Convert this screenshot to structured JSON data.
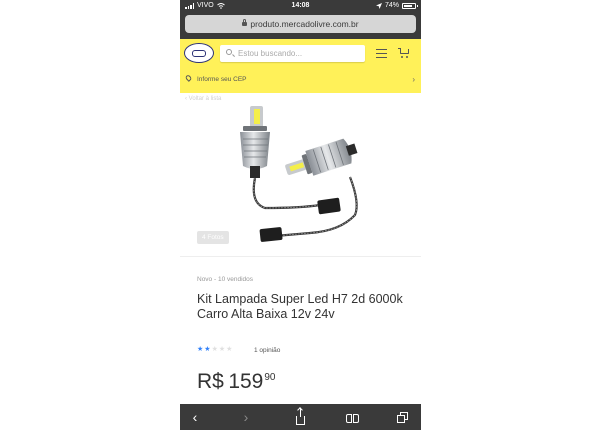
{
  "status_bar": {
    "carrier": "VIVO",
    "time": "14:08",
    "battery": "74%"
  },
  "browser": {
    "url": "produto.mercadolivre.com.br"
  },
  "header": {
    "search_placeholder": "Estou buscando...",
    "cep_label": "Informe seu CEP",
    "cep_chevron": "›"
  },
  "gallery": {
    "back_label": "‹ Voltar à lista",
    "photo_count": "4 Fotos"
  },
  "product": {
    "condition": "Novo  -  10 vendidos",
    "title": "Kit Lampada Super Led H7 2d 6000k Carro Alta Baixa 12v 24v",
    "rating": 2,
    "rating_max": 5,
    "reviews": "1 opinião",
    "price_currency": "R$",
    "price_integer": "159",
    "price_cents": "90"
  },
  "toolbar": {
    "back": "‹",
    "forward": "›"
  },
  "colors": {
    "brand_yellow": "#fff159",
    "star_filled": "#3483fa",
    "star_empty": "#e0e0e0"
  }
}
